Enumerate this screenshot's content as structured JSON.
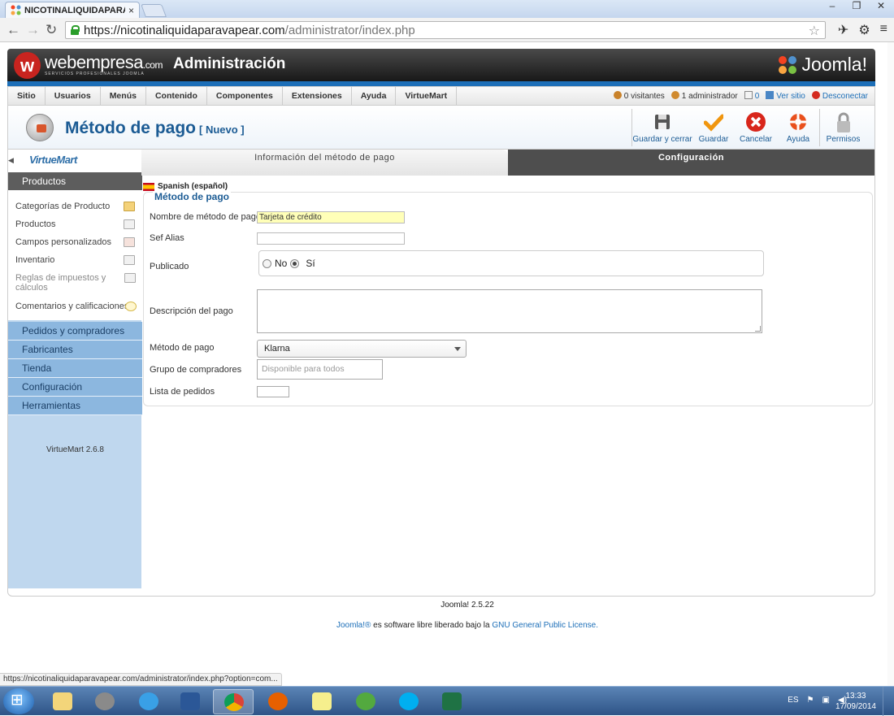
{
  "browser": {
    "tab_title": "NICOTINALIQUIDAPARAV",
    "tab_close": "×",
    "window_controls": [
      "–",
      "❐",
      "✕"
    ],
    "back_icon": "arrow-left-icon",
    "url_host": "https://nicotinaliquidaparavapear.com",
    "url_path": "/administrator/index.php",
    "status_url": "https://nicotinaliquidaparavapear.com/administrator/index.php?option=com..."
  },
  "header": {
    "brand_mark": "w",
    "brand": "webempresa",
    "brand_suffix": ".com",
    "brand_tagline": "SERVICIOS PROFESIONALES JOOMLA",
    "admin_title": "Administración",
    "joomla_logo": "Joomla!"
  },
  "menu": {
    "items": [
      "Sitio",
      "Usuarios",
      "Menús",
      "Contenido",
      "Componentes",
      "Extensiones",
      "Ayuda",
      "VirtueMart"
    ]
  },
  "status": {
    "visitors": "0 visitantes",
    "admins": "1 administrador",
    "messages": "0",
    "view_site": "Ver sitio",
    "logout": "Desconectar"
  },
  "toolbar": {
    "title": "Método de pago",
    "subtitle": "[ Nuevo ]",
    "save_close": "Guardar y cerrar",
    "save": "Guardar",
    "cancel": "Cancelar",
    "help": "Ayuda",
    "permissions": "Permisos"
  },
  "sidebar": {
    "logo": "VirtueMart",
    "head": "Productos",
    "items": [
      "Categorías de Producto",
      "Productos",
      "Campos personalizados",
      "Inventario",
      "Reglas de impuestos y cálculos",
      "Comentarios y calificaciones"
    ],
    "categories": [
      "Pedidos y compradores",
      "Fabricantes",
      "Tienda",
      "Configuración",
      "Herramientas"
    ],
    "version": "VirtueMart 2.6.8"
  },
  "tabs": {
    "info": "Información del método de pago",
    "config": "Configuración"
  },
  "form": {
    "language": "Spanish (español)",
    "legend": "Método de pago",
    "name_label": "Nombre de método de pago",
    "name_value": "Tarjeta de crédito",
    "alias_label": "Sef Alias",
    "alias_value": "",
    "published_label": "Publicado",
    "opt_no": "No",
    "opt_yes": "Sí",
    "description_label": "Descripción del pago",
    "method_label": "Método de pago",
    "method_value": "Klarna",
    "group_label": "Grupo de compradores",
    "group_placeholder": "Disponible para todos",
    "order_label": "Lista de pedidos"
  },
  "footer": {
    "version": "Joomla! 2.5.22",
    "license_prefix": "Joomla!® ",
    "license_mid": "es software libre liberado bajo la ",
    "license_link": "GNU General Public License."
  },
  "taskbar": {
    "lang": "ES",
    "time": "13:33",
    "date": "17/09/2014"
  },
  "colors": {
    "brand_blue": "#1b5b94",
    "stripe": "#1d6fb8",
    "sidebar": "#bfd7ee"
  }
}
